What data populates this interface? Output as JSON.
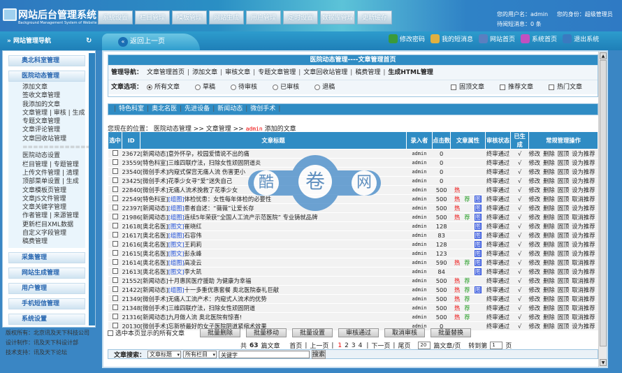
{
  "header": {
    "title": "网站后台管理系统",
    "subtitle": "Background Management System of Website",
    "top_nav": [
      "系统设置",
      "栏目管理",
      "模板管理",
      "网站生成",
      "用户管理",
      "定时设置",
      "数据库管理",
      "更新缓存"
    ],
    "user_label": "您的用户名：admin",
    "role_label": "您的身份：超级管理员",
    "messages_label": "待阅短消息：0 条"
  },
  "quick_links": [
    {
      "label": "修改密码",
      "icon": "edit-password-icon",
      "color": "#3a9a3a"
    },
    {
      "label": "我的短消息",
      "icon": "message-icon",
      "color": "#e0b040"
    },
    {
      "label": "网站首页",
      "icon": "home-icon",
      "color": "#5a7fc0"
    },
    {
      "label": "系统首页",
      "icon": "chart-icon",
      "color": "#c050c0"
    },
    {
      "label": "退出系统",
      "icon": "logout-icon",
      "color": "#3a7ac0"
    }
  ],
  "back_label": "返回上一页",
  "sidebar": {
    "title": "网站管理导航",
    "group_top": "奥北科室管理",
    "group_open": "医院动态管理",
    "items": [
      "添加文章",
      "签收文章管理",
      "我添加的文章",
      "文章管理 | 审核 | 生成",
      "专题文章管理",
      "文章评论管理",
      "文章回收站管理",
      "======================",
      "医院动态设置",
      "栏目管理 | 专题管理",
      "上传文件管理 | 清理",
      "顶部菜单设置 | 生成",
      "文章模板页管理",
      "文章JS文件管理",
      "文章关键字管理",
      "作者管理 | 来源管理",
      "更新栏目XML数据",
      "自定义字段管理",
      "稿费管理"
    ],
    "groups": [
      "采集管理",
      "网站生成管理",
      "用户管理",
      "手机短信管理",
      "系统设置"
    ],
    "footer": [
      "版权所有：北京讯及天下科技公司",
      "设计制作：讯及天下科设计部",
      "技术支持：讯及天下论坛"
    ]
  },
  "panel": {
    "title": "医院动态管理----文章管理首页",
    "nav_label": "管理导航：",
    "nav_links": [
      "文章管理首页",
      "添加文章",
      "审核文章",
      "专题文章管理",
      "文章回收站管理",
      "稿费管理"
    ],
    "nav_bold": "生成HTML管理",
    "options_label": "文章选项：",
    "radios": [
      "所有文章",
      "草稿",
      "待审核",
      "已审核",
      "退稿"
    ],
    "radio_selected": 0,
    "checks": [
      "固顶文章",
      "推荐文章",
      "热门文章"
    ]
  },
  "categories": [
    "特色科室",
    "奥北名医",
    "先进设备",
    "新闻动态",
    "微创手术"
  ],
  "crumb": {
    "prefix": "您现在的位置：",
    "path1": "医院动态管理",
    "sep": ">>",
    "path2": "文章管理",
    "user": "admin",
    "suffix": "添加的文章"
  },
  "table": {
    "headers": [
      "选中",
      "ID",
      "文章标题",
      "录入者",
      "点击数",
      "文章属性",
      "审核状态",
      "已生成",
      "常规管理操作"
    ],
    "ops": [
      "修改",
      "删除",
      "固顶"
    ],
    "rows": [
      {
        "id": "23672",
        "cat": "[新闻动态]",
        "tag": "",
        "title": "意外怀孕，校园爱情说不出的痛",
        "author": "admin",
        "clicks": "0",
        "hot": false,
        "rec": false,
        "pic": false,
        "status": "终审通过",
        "gen": "√",
        "recop": "设为推荐"
      },
      {
        "id": "23559",
        "cat": "[特色科室]",
        "tag": "",
        "title": "三维四联疗法，扫除女性顽固阴道炎",
        "author": "admin",
        "clicks": "0",
        "hot": false,
        "rec": false,
        "pic": false,
        "status": "终审通过",
        "gen": "√",
        "recop": "设为推荐"
      },
      {
        "id": "23540",
        "cat": "[微创手术]",
        "tag": "",
        "title": "内窥式保宫无痛人流 伤害更小",
        "author": "admin",
        "clicks": "0",
        "hot": false,
        "rec": false,
        "pic": false,
        "status": "终审通过",
        "gen": "√",
        "recop": "设为推荐"
      },
      {
        "id": "23425",
        "cat": "[微创手术]",
        "tag": "",
        "title": "花季少女寻“爱”迷失自己",
        "author": "admin",
        "clicks": "0",
        "hot": false,
        "rec": false,
        "pic": false,
        "status": "终审通过",
        "gen": "√",
        "recop": "设为推荐"
      },
      {
        "id": "22840",
        "cat": "[微创手术]",
        "tag": "",
        "title": "无痛人流术挽救了花季少女",
        "author": "admin",
        "clicks": "500",
        "hot": true,
        "rec": false,
        "pic": false,
        "status": "终审通过",
        "gen": "√",
        "recop": "设为推荐"
      },
      {
        "id": "22549",
        "cat": "[特色科室]",
        "tag": "[组图]",
        "title": "体检忧患：女性每年体检的必要性",
        "author": "admin",
        "clicks": "500",
        "hot": true,
        "rec": true,
        "pic": true,
        "status": "终审通过",
        "gen": "√",
        "recop": "取消推荐"
      },
      {
        "id": "22397",
        "cat": "[新闻动态]",
        "tag": "[组图]",
        "title": "患者自述：“薇薇”让爱长存",
        "author": "admin",
        "clicks": "500",
        "hot": true,
        "rec": false,
        "pic": true,
        "status": "终审通过",
        "gen": "√",
        "recop": "设为推荐"
      },
      {
        "id": "21986",
        "cat": "[新闻动态]",
        "tag": "[组图]",
        "title": "连续5年荣获“全国人工流产示范医院” 专业铸就品牌",
        "author": "admin",
        "clicks": "500",
        "hot": true,
        "rec": true,
        "pic": true,
        "status": "终审通过",
        "gen": "√",
        "recop": "取消推荐"
      },
      {
        "id": "21618",
        "cat": "[奥北名医]",
        "tag": "[图文]",
        "title": "崔晓红",
        "author": "admin",
        "clicks": "128",
        "hot": false,
        "rec": false,
        "pic": true,
        "status": "终审通过",
        "gen": "√",
        "recop": "设为推荐"
      },
      {
        "id": "21617",
        "cat": "[奥北名医]",
        "tag": "[组图]",
        "title": "石容伟",
        "author": "admin",
        "clicks": "83",
        "hot": false,
        "rec": false,
        "pic": true,
        "status": "终审通过",
        "gen": "√",
        "recop": "设为推荐"
      },
      {
        "id": "21616",
        "cat": "[奥北名医]",
        "tag": "[图文]",
        "title": "王莉莉",
        "author": "admin",
        "clicks": "128",
        "hot": false,
        "rec": false,
        "pic": true,
        "status": "终审通过",
        "gen": "√",
        "recop": "设为推荐"
      },
      {
        "id": "21615",
        "cat": "[奥北名医]",
        "tag": "[图文]",
        "title": "彭永峰",
        "author": "admin",
        "clicks": "123",
        "hot": false,
        "rec": false,
        "pic": true,
        "status": "终审通过",
        "gen": "√",
        "recop": "设为推荐"
      },
      {
        "id": "21614",
        "cat": "[奥北名医]",
        "tag": "[组图]",
        "title": "高凌云",
        "author": "admin",
        "clicks": "590",
        "hot": true,
        "rec": true,
        "pic": true,
        "status": "终审通过",
        "gen": "√",
        "recop": "取消推荐"
      },
      {
        "id": "21613",
        "cat": "[奥北名医]",
        "tag": "[图文]",
        "title": "李大凯",
        "author": "admin",
        "clicks": "84",
        "hot": false,
        "rec": false,
        "pic": true,
        "status": "终审通过",
        "gen": "√",
        "recop": "设为推荐"
      },
      {
        "id": "21552",
        "cat": "[新闻动态]",
        "tag": "",
        "title": "十月惠民医疗援助 为健康为幸福",
        "author": "admin",
        "clicks": "500",
        "hot": true,
        "rec": true,
        "pic": false,
        "status": "终审通过",
        "gen": "√",
        "recop": "取消推荐"
      },
      {
        "id": "21422",
        "cat": "[新闻动态]",
        "tag": "[组图]",
        "title": "十一多重优惠套餐 奥北医院泰礼巨献",
        "author": "admin",
        "clicks": "500",
        "hot": true,
        "rec": true,
        "pic": true,
        "status": "终审通过",
        "gen": "√",
        "recop": "取消推荐"
      },
      {
        "id": "21349",
        "cat": "[微创手术]",
        "tag": "",
        "title": "无痛人工流产术：内窥式人流术的优势",
        "author": "admin",
        "clicks": "500",
        "hot": true,
        "rec": true,
        "pic": false,
        "status": "终审通过",
        "gen": "√",
        "recop": "取消推荐"
      },
      {
        "id": "21348",
        "cat": "[微创手术]",
        "tag": "",
        "title": "三维四联疗法，扫除女性顽固阴道",
        "author": "admin",
        "clicks": "500",
        "hot": true,
        "rec": true,
        "pic": false,
        "status": "终审通过",
        "gen": "√",
        "recop": "取消推荐"
      },
      {
        "id": "21316",
        "cat": "[新闻动态]",
        "tag": "",
        "title": "九月做人流 奥北医院有惊喜!",
        "author": "admin",
        "clicks": "500",
        "hot": true,
        "rec": true,
        "pic": false,
        "status": "终审通过",
        "gen": "√",
        "recop": "取消推荐"
      },
      {
        "id": "20130",
        "cat": "[微创手术]",
        "tag": "",
        "title": "忘新桥最好的女子医院阴道紧缩术效果",
        "author": "admin",
        "clicks": "0",
        "hot": false,
        "rec": false,
        "pic": false,
        "status": "终审通过",
        "gen": "√",
        "recop": "设为推荐"
      }
    ],
    "attr_labels": {
      "hot": "热",
      "rec": "荐",
      "pic": "图"
    }
  },
  "batch": {
    "select_all": "选中本页显示的所有文章",
    "buttons": [
      "批量删除",
      "批量移动",
      "批量设置",
      "审核通过",
      "取消审核",
      "批量替换"
    ]
  },
  "pager": {
    "total_prefix": "共",
    "total": "63",
    "total_suffix": "篇文章",
    "first": "首页",
    "prev": "上一页",
    "pages": [
      "1",
      "2",
      "3",
      "4"
    ],
    "current": "1",
    "next": "下一页",
    "last": "尾页",
    "per_page": "20",
    "per_page_suffix": "篇文章/页",
    "goto_label": "转到第",
    "goto_value": "1",
    "goto_suffix": "页"
  },
  "search": {
    "label": "文章搜索：",
    "field": "文章标题",
    "column": "所有栏目",
    "keyword": "关键字",
    "button": "搜索"
  },
  "watermark": [
    "酷",
    "卷",
    "网"
  ]
}
